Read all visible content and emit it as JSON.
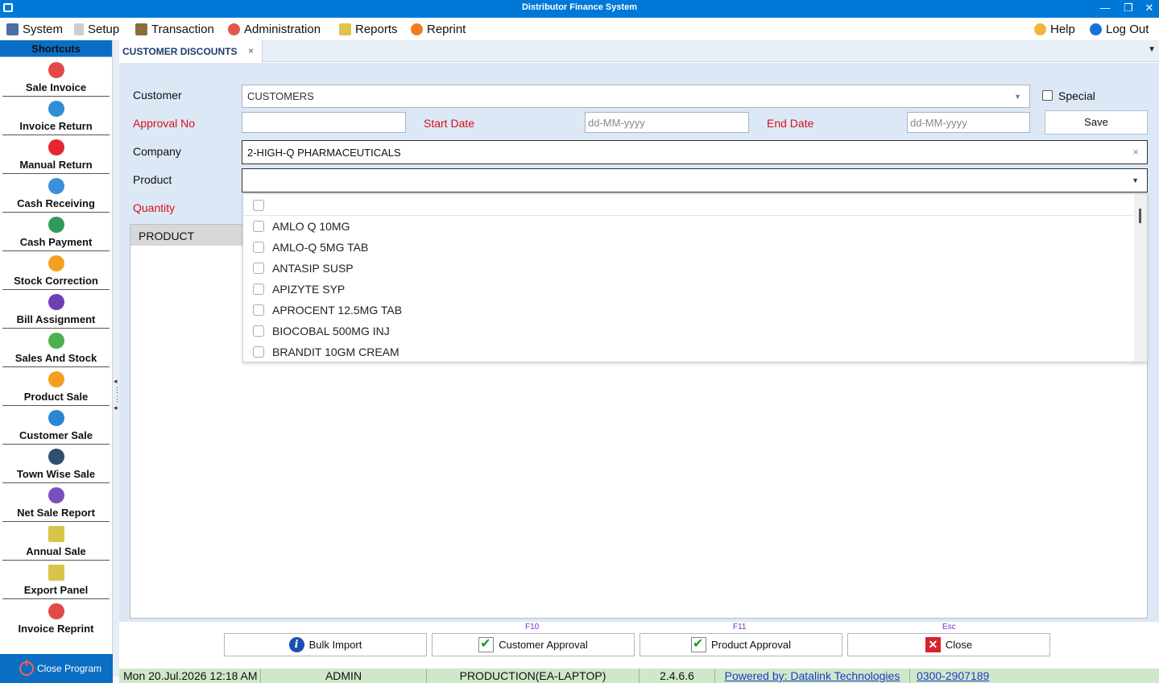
{
  "window": {
    "title": "Distributor Finance System",
    "minimize": "—",
    "restore": "❐",
    "close": "✕"
  },
  "menu": {
    "left": [
      {
        "label": "System",
        "icon": "computer-icon",
        "color": "#4a6fa5"
      },
      {
        "label": "Setup",
        "icon": "document-icon",
        "color": "#c9ced6"
      },
      {
        "label": "Transaction",
        "icon": "tools-icon",
        "color": "#8a6d3b"
      },
      {
        "label": "Administration",
        "icon": "admin-icon",
        "color": "#e05a4e"
      },
      {
        "label": "Reports",
        "icon": "reports-icon",
        "color": "#e2c34a"
      },
      {
        "label": "Reprint",
        "icon": "printer-icon",
        "color": "#f07b20"
      }
    ],
    "right": [
      {
        "label": "Help",
        "icon": "help-icon",
        "color": "#f2b43a"
      },
      {
        "label": "Log Out",
        "icon": "lock-icon",
        "color": "#1a72d9"
      }
    ]
  },
  "sidebar": {
    "header": "Shortcuts",
    "items": [
      {
        "label": "Sale Invoice",
        "icon": "sale-invoice-icon",
        "color": "#e24a4a"
      },
      {
        "label": "Invoice Return",
        "icon": "invoice-return-icon",
        "color": "#2f8fd6"
      },
      {
        "label": "Manual Return",
        "icon": "manual-return-icon",
        "color": "#e8262e"
      },
      {
        "label": "Cash Receiving",
        "icon": "cash-receiving-icon",
        "color": "#3c8fd9"
      },
      {
        "label": "Cash Payment",
        "icon": "cash-payment-icon",
        "color": "#2e9b5b"
      },
      {
        "label": "Stock Correction",
        "icon": "stock-correction-icon",
        "color": "#f3a020"
      },
      {
        "label": "Bill Assignment",
        "icon": "bill-assignment-icon",
        "color": "#6d3fb5"
      },
      {
        "label": "Sales And Stock",
        "icon": "sales-stock-icon",
        "color": "#4caf50"
      },
      {
        "label": "Product Sale",
        "icon": "product-sale-icon",
        "color": "#f3a020"
      },
      {
        "label": "Customer Sale",
        "icon": "customer-sale-icon",
        "color": "#2a86d4"
      },
      {
        "label": "Town Wise Sale",
        "icon": "town-sale-icon",
        "color": "#2f4f6f"
      },
      {
        "label": "Net Sale Report",
        "icon": "net-sale-icon",
        "color": "#7a4fc0"
      },
      {
        "label": "Annual Sale",
        "icon": "annual-sale-icon",
        "color": "#d9c44a"
      },
      {
        "label": "Export Panel",
        "icon": "export-panel-icon",
        "color": "#d9c44a"
      },
      {
        "label": "Invoice Reprint",
        "icon": "invoice-reprint-icon",
        "color": "#e24a4a"
      }
    ],
    "close_program": "Close Program"
  },
  "tab": {
    "label": "CUSTOMER DISCOUNTS",
    "close": "×"
  },
  "form": {
    "customer_label": "Customer",
    "customer_value": "CUSTOMERS",
    "special_label": "Special",
    "approval_label": "Approval No",
    "approval_value": "",
    "start_date_label": "Start Date",
    "start_date_placeholder": "dd-MM-yyyy",
    "end_date_label": "End Date",
    "end_date_placeholder": "dd-MM-yyyy",
    "save_label": "Save",
    "company_label": "Company",
    "company_value": "2-HIGH-Q PHARMACEUTICALS",
    "product_label": "Product",
    "product_value": "",
    "quantity_label": "Quantity"
  },
  "grid": {
    "columns": [
      "PRODUCT"
    ]
  },
  "dropdown": {
    "options": [
      "AMLO Q 10MG",
      "AMLO-Q 5MG TAB",
      "ANTASIP SUSP",
      "APIZYTE SYP",
      "APROCENT 12.5MG TAB",
      "BIOCOBAL 500MG INJ",
      "BRANDIT 10GM CREAM"
    ]
  },
  "actions": [
    {
      "label": "Bulk Import",
      "key": "",
      "icon": "info-icon"
    },
    {
      "label": "Customer Approval",
      "key": "F10",
      "icon": "approval-check-icon"
    },
    {
      "label": "Product Approval",
      "key": "F11",
      "icon": "approval-check-icon"
    },
    {
      "label": "Close",
      "key": "Esc",
      "icon": "close-icon"
    }
  ],
  "status": {
    "datetime": "Mon 20.Jul.2026  12:18 AM",
    "user": "ADMIN",
    "server": "PRODUCTION(EA-LAPTOP)",
    "version": "2.4.6.6",
    "powered_by": "Powered by: Datalink Technologies",
    "phone": "0300-2907189"
  }
}
